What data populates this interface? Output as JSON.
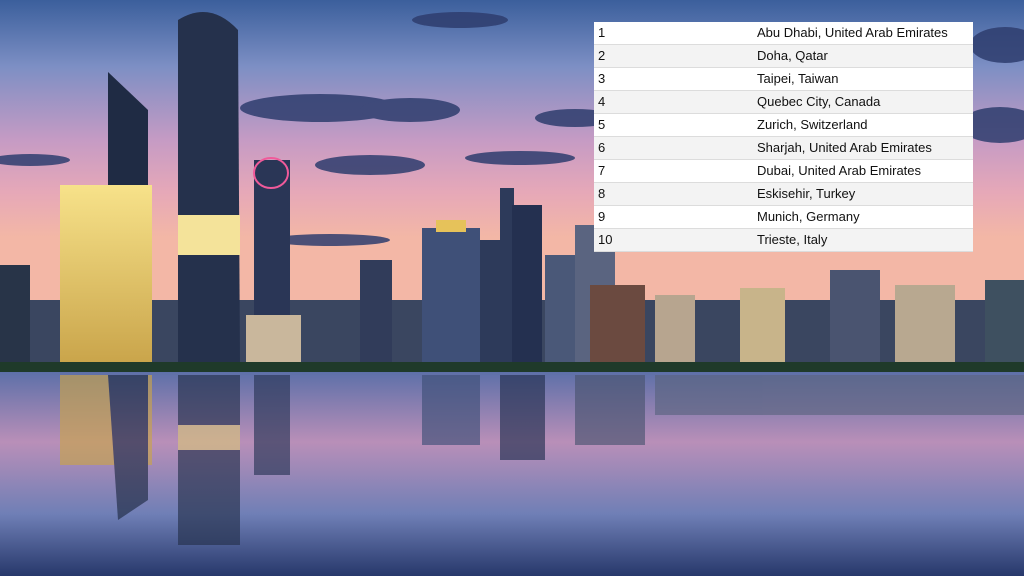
{
  "rankings": [
    {
      "rank": "1",
      "city": "Abu Dhabi, United Arab Emirates"
    },
    {
      "rank": "2",
      "city": "Doha, Qatar"
    },
    {
      "rank": "3",
      "city": "Taipei, Taiwan"
    },
    {
      "rank": "4",
      "city": "Quebec City, Canada"
    },
    {
      "rank": "5",
      "city": "Zurich, Switzerland"
    },
    {
      "rank": "6",
      "city": "Sharjah, United Arab Emirates"
    },
    {
      "rank": "7",
      "city": "Dubai, United Arab Emirates"
    },
    {
      "rank": "8",
      "city": "Eskisehir, Turkey"
    },
    {
      "rank": "9",
      "city": "Munich, Germany"
    },
    {
      "rank": "10",
      "city": "Trieste, Italy"
    }
  ]
}
